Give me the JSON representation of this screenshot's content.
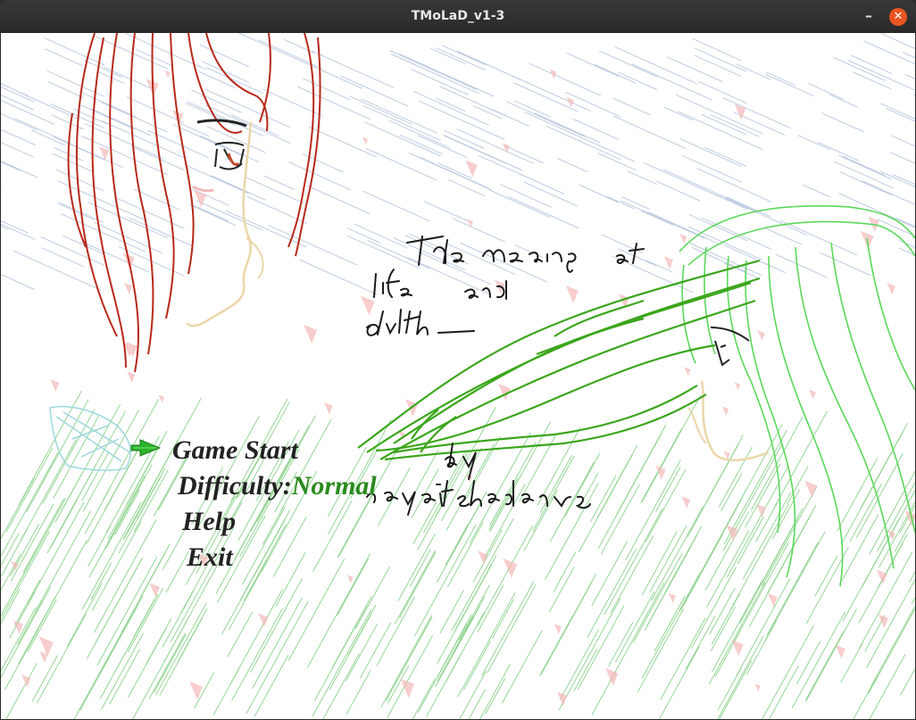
{
  "window": {
    "title": "TMoLaD_v1-3",
    "minimize_glyph": "–",
    "close_glyph": "✕"
  },
  "menu": {
    "items": [
      {
        "id": "game-start",
        "label": "Game Start"
      },
      {
        "id": "difficulty",
        "label": "Difficulty:",
        "value": "Normal"
      },
      {
        "id": "help",
        "label": "Help"
      },
      {
        "id": "exit",
        "label": "Exit"
      }
    ],
    "selected": "game-start",
    "pointer_icon": "green-arrow-icon"
  },
  "colors": {
    "difficulty_value": "#2a8a1e",
    "menu_text": "#222222",
    "close_button": "#e95420",
    "pointer": "#2ab52a"
  }
}
